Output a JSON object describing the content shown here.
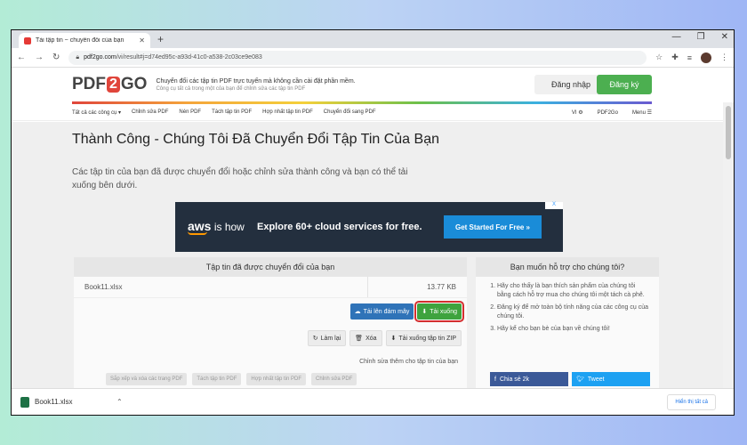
{
  "browser": {
    "tab_title": "Tải tập tin ~ chuyển đổi của bạn",
    "url_domain": "pdf2go.com",
    "url_path": "/vi/result#j=d74ed95c-a93d-41c0-a538-2c03ce9e083",
    "download_file": "Book11.xlsx",
    "show_all": "Hiển thị tất cả"
  },
  "header": {
    "logo_pre": "PDF",
    "logo_2": "2",
    "logo_post": "GO",
    "tagline": "Chuyển đổi các tập tin PDF trực tuyến mà không cần cài đặt phần mềm.",
    "tagline_sub": "Công cụ tất cả trong một của bạn để chỉnh sửa các tập tin PDF",
    "login": "Đăng nhập",
    "signup": "Đăng ký"
  },
  "nav": {
    "items": [
      "Tất cả các công cụ ▾",
      "Chỉnh sửa PDF",
      "Nén PDF",
      "Tách tập tin PDF",
      "Hợp nhất tập tin PDF",
      "Chuyển đổi sang PDF"
    ],
    "lang": "VI ⚙",
    "brand": "PDF2Go",
    "menu": "Menu ☰"
  },
  "main": {
    "title": "Thành Công - Chúng Tôi Đã Chuyển Đổi Tập Tin Của Bạn",
    "subtitle": "Các tập tin của bạn đã được chuyển đổi hoặc chỉnh sửa thành công và bạn có thể tải xuống bên dưới."
  },
  "ad": {
    "brand": "aws",
    "brand_suffix": "is how",
    "message": "Explore 60+ cloud services for free.",
    "cta": "Get Started For Free »",
    "badge": "X"
  },
  "files": {
    "panel_title": "Tập tin đã được chuyển đổi của bạn",
    "file_name": "Book11.xlsx",
    "file_size": "13.77 KB",
    "upload_cloud": "Tải lên đám mây",
    "download": "Tải xuống",
    "redo": "Làm lại",
    "delete": "Xóa",
    "download_zip": "Tải xuống tập tin ZIP",
    "edit_more": "Chỉnh sửa thêm cho tập tin của bạn",
    "ghost_buttons": [
      "Sắp xếp và xóa các trang PDF",
      "Tách tập tin PDF",
      "Hợp nhất tập tin PDF",
      "Chỉnh sửa PDF"
    ]
  },
  "help": {
    "title": "Bạn muốn hỗ trợ cho chúng tôi?",
    "items": [
      "Hãy cho thấy là bạn thích sản phẩm của chúng tôi bằng cách hỗ trợ mua cho chúng tôi một tách cà phê.",
      "Đăng ký để mở toàn bộ tính năng của các công cụ của chúng tôi.",
      "Hãy kể cho bạn bè của bạn về chúng tôi!"
    ],
    "fb": "Chia sẻ 2k",
    "tw": "Tweet"
  }
}
